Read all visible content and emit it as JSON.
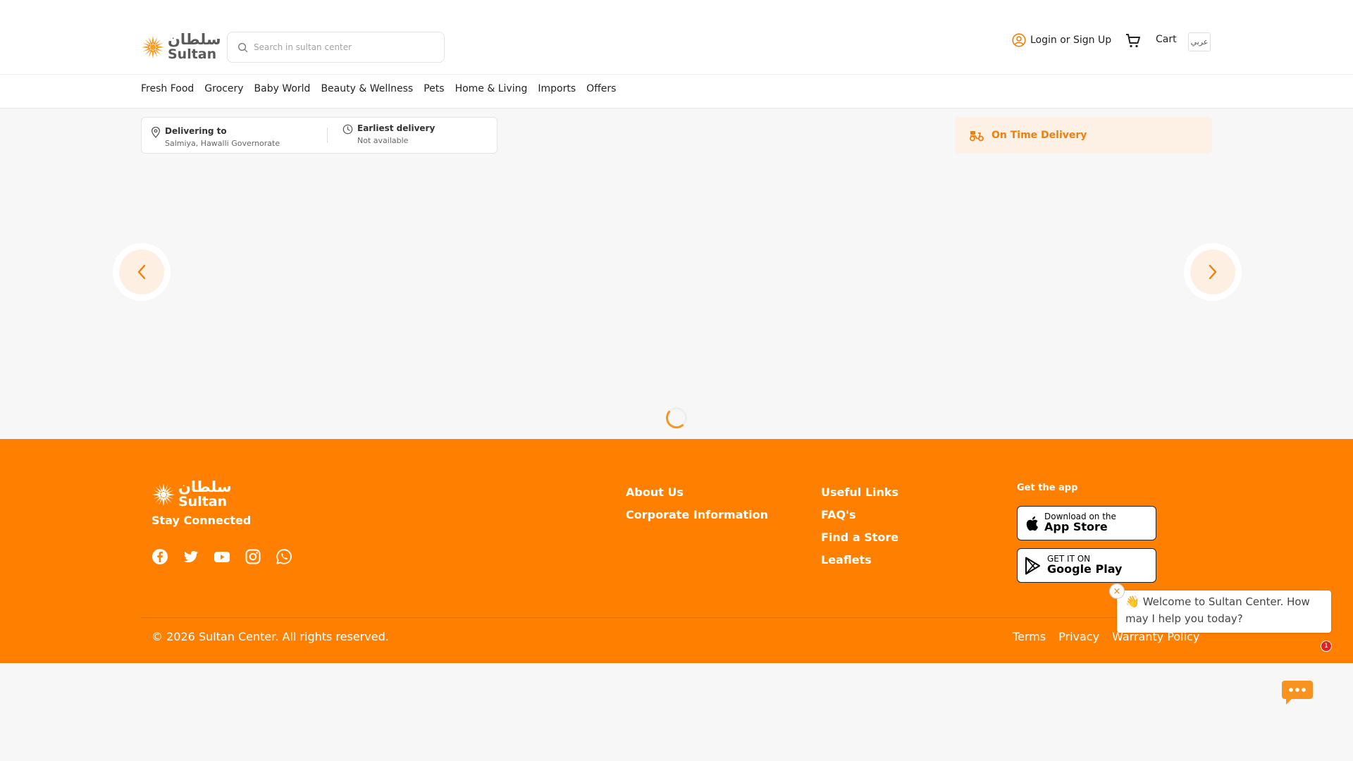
{
  "header": {
    "logo_ar": "سلطان",
    "logo_en": "Sultan",
    "search_placeholder": "Search in sultan center",
    "login_label": "Login or Sign Up",
    "cart_label": "Cart",
    "language_label": "عربي"
  },
  "nav": {
    "items": [
      {
        "label": "Fresh Food"
      },
      {
        "label": "Grocery"
      },
      {
        "label": "Baby World"
      },
      {
        "label": "Beauty & Wellness"
      },
      {
        "label": "Pets"
      },
      {
        "label": "Home & Living"
      },
      {
        "label": "Imports"
      },
      {
        "label": "Offers"
      }
    ]
  },
  "delivery": {
    "to_title": "Delivering to",
    "to_value": "Salmiya, Hawalli Governorate",
    "earliest_title": "Earliest delivery",
    "earliest_value": "Not available",
    "on_time_label": "On Time Delivery"
  },
  "footer": {
    "logo_ar": "سلطان",
    "logo_en": "Sultan",
    "stay_connected": "Stay Connected",
    "socials": [
      "facebook-icon",
      "twitter-icon",
      "youtube-icon",
      "instagram-icon",
      "whatsapp-icon"
    ],
    "col1": [
      {
        "label": "About Us"
      },
      {
        "label": "Corporate Information"
      }
    ],
    "col2": [
      {
        "label": "Useful Links"
      },
      {
        "label": "FAQ's"
      },
      {
        "label": "Find a Store"
      },
      {
        "label": "Leaflets"
      }
    ],
    "get_app": "Get the app",
    "app_store": {
      "small": "Download on the",
      "big": "App Store"
    },
    "google_play": {
      "small": "GET IT ON",
      "big": "Google Play"
    },
    "copyright": "© 2026 Sultan Center. All rights reserved.",
    "legal": [
      {
        "label": "Terms"
      },
      {
        "label": "Privacy"
      },
      {
        "label": "Warranty Policy"
      }
    ]
  },
  "chat": {
    "message": "Welcome to Sultan Center. How may I help you today?",
    "emoji": "👋",
    "badge": "1",
    "close_glyph": "×"
  },
  "colors": {
    "accent": "#ff8000",
    "accent_light": "#fdefe1",
    "badge": "#e02424"
  }
}
